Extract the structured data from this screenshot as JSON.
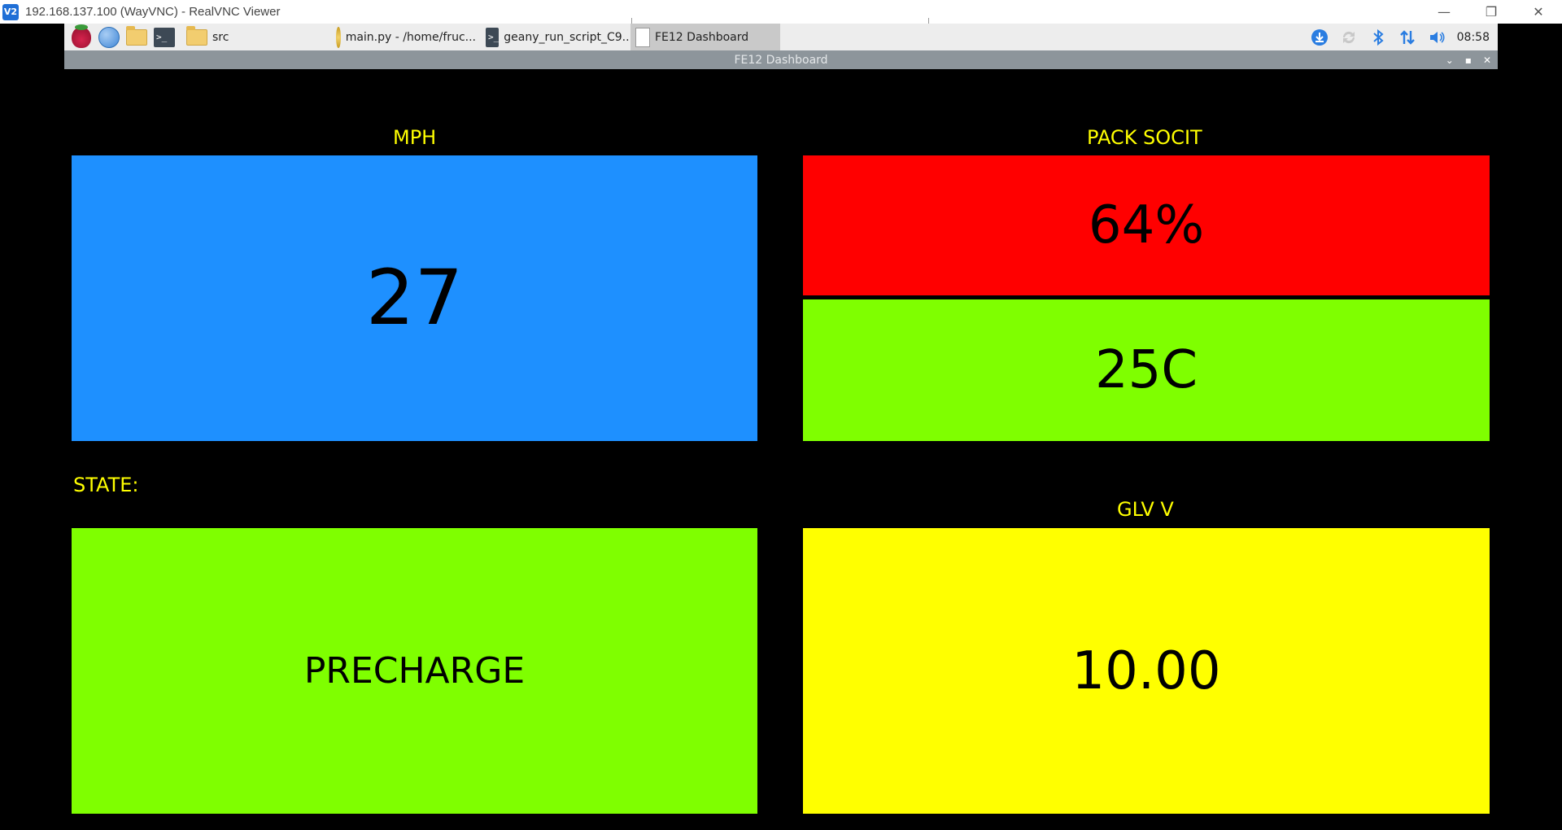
{
  "host": {
    "title": "192.168.137.100 (WayVNC) - RealVNC Viewer",
    "app_icon": "realvnc-icon",
    "controls": {
      "minimize": "—",
      "restore": "❐",
      "close": "✕"
    }
  },
  "taskbar": {
    "items": [
      {
        "label": "src",
        "icon": "folder-icon"
      },
      {
        "label": "main.py - /home/fruc...",
        "icon": "geany-icon"
      },
      {
        "label": "geany_run_script_C9...",
        "icon": "terminal-icon"
      },
      {
        "label": "FE12 Dashboard",
        "icon": "window-icon"
      }
    ],
    "clock": "08:58",
    "tray_icons": [
      "download-icon",
      "sync-icon",
      "bluetooth-icon",
      "network-icon",
      "volume-icon"
    ]
  },
  "window": {
    "title": "FE12 Dashboard"
  },
  "dashboard": {
    "mph": {
      "label": "MPH",
      "value": "27",
      "color": "#1e90ff"
    },
    "pack": {
      "label": "PACK SOCIT",
      "soc": "64%",
      "soc_color": "#ff0000",
      "temp": "25C",
      "temp_color": "#7fff00"
    },
    "state": {
      "label": "STATE:",
      "value": "PRECHARGE",
      "color": "#7fff00"
    },
    "glv": {
      "label": "GLV V",
      "value": "10.00",
      "color": "#ffff00"
    },
    "label_color": "#ffff00"
  }
}
